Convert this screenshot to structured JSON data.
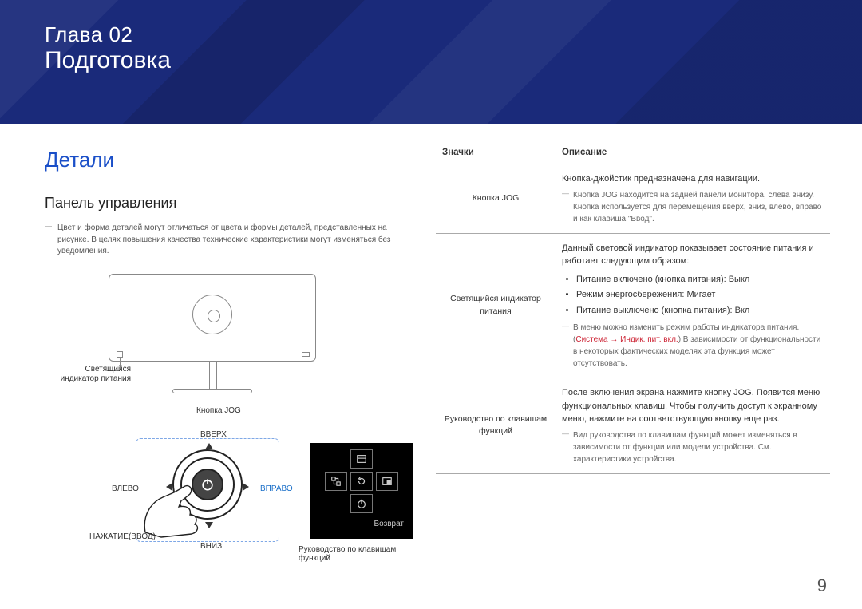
{
  "header": {
    "chapter_line": "Глава 02",
    "title": "Подготовка"
  },
  "left": {
    "section_title": "Детали",
    "subsection": "Панель управления",
    "note": "Цвет и форма деталей могут отличаться от цвета и формы деталей, представленных на рисунке. В целях повышения качества технические характеристики могут изменяться без уведомления.",
    "labels": {
      "led": "Светящийся\nиндикатор питания",
      "jog": "Кнопка JOG",
      "up": "ВВЕРХ",
      "down": "ВНИЗ",
      "left": "ВЛЕВО",
      "right": "ВПРАВО",
      "press": "НАЖАТИЕ(ВВОД)"
    },
    "osd": {
      "return": "Возврат",
      "caption": "Руководство по клавишам функций"
    }
  },
  "table": {
    "head": {
      "col1": "Значки",
      "col2": "Описание"
    },
    "rows": [
      {
        "name": "Кнопка JOG",
        "body": "Кнопка-джойстик предназначена для навигации.",
        "notes": [
          "Кнопка JOG находится на задней панели монитора, слева внизу. Кнопка используется для перемещения вверх, вниз, влево, вправо и как клавиша \"Ввод\"."
        ]
      },
      {
        "name": "Светящийся индикатор питания",
        "body": "Данный световой индикатор показывает состояние питания и работает следующим образом:",
        "list": [
          "Питание включено (кнопка питания): Выкл",
          "Режим энергосбережения: Мигает",
          "Питание выключено (кнопка питания): Вкл"
        ],
        "notes": [
          "В меню можно изменить режим работы индикатора питания. (Система → Индик. пит. вкл.) В зависимости от функциональности в некоторых фактических моделях эта функция может отсутствовать."
        ],
        "red_span": "Система → Индик. пит. вкл."
      },
      {
        "name": "Руководство по клавишам функций",
        "body": "После включения экрана нажмите кнопку JOG. Появится меню функциональных клавиш. Чтобы получить доступ к экранному меню, нажмите на соответствующую кнопку еще раз.",
        "notes": [
          "Вид руководства по клавишам функций может изменяться в зависимости от функции или модели устройства. См. характеристики устройства."
        ]
      }
    ]
  },
  "page_number": "9"
}
